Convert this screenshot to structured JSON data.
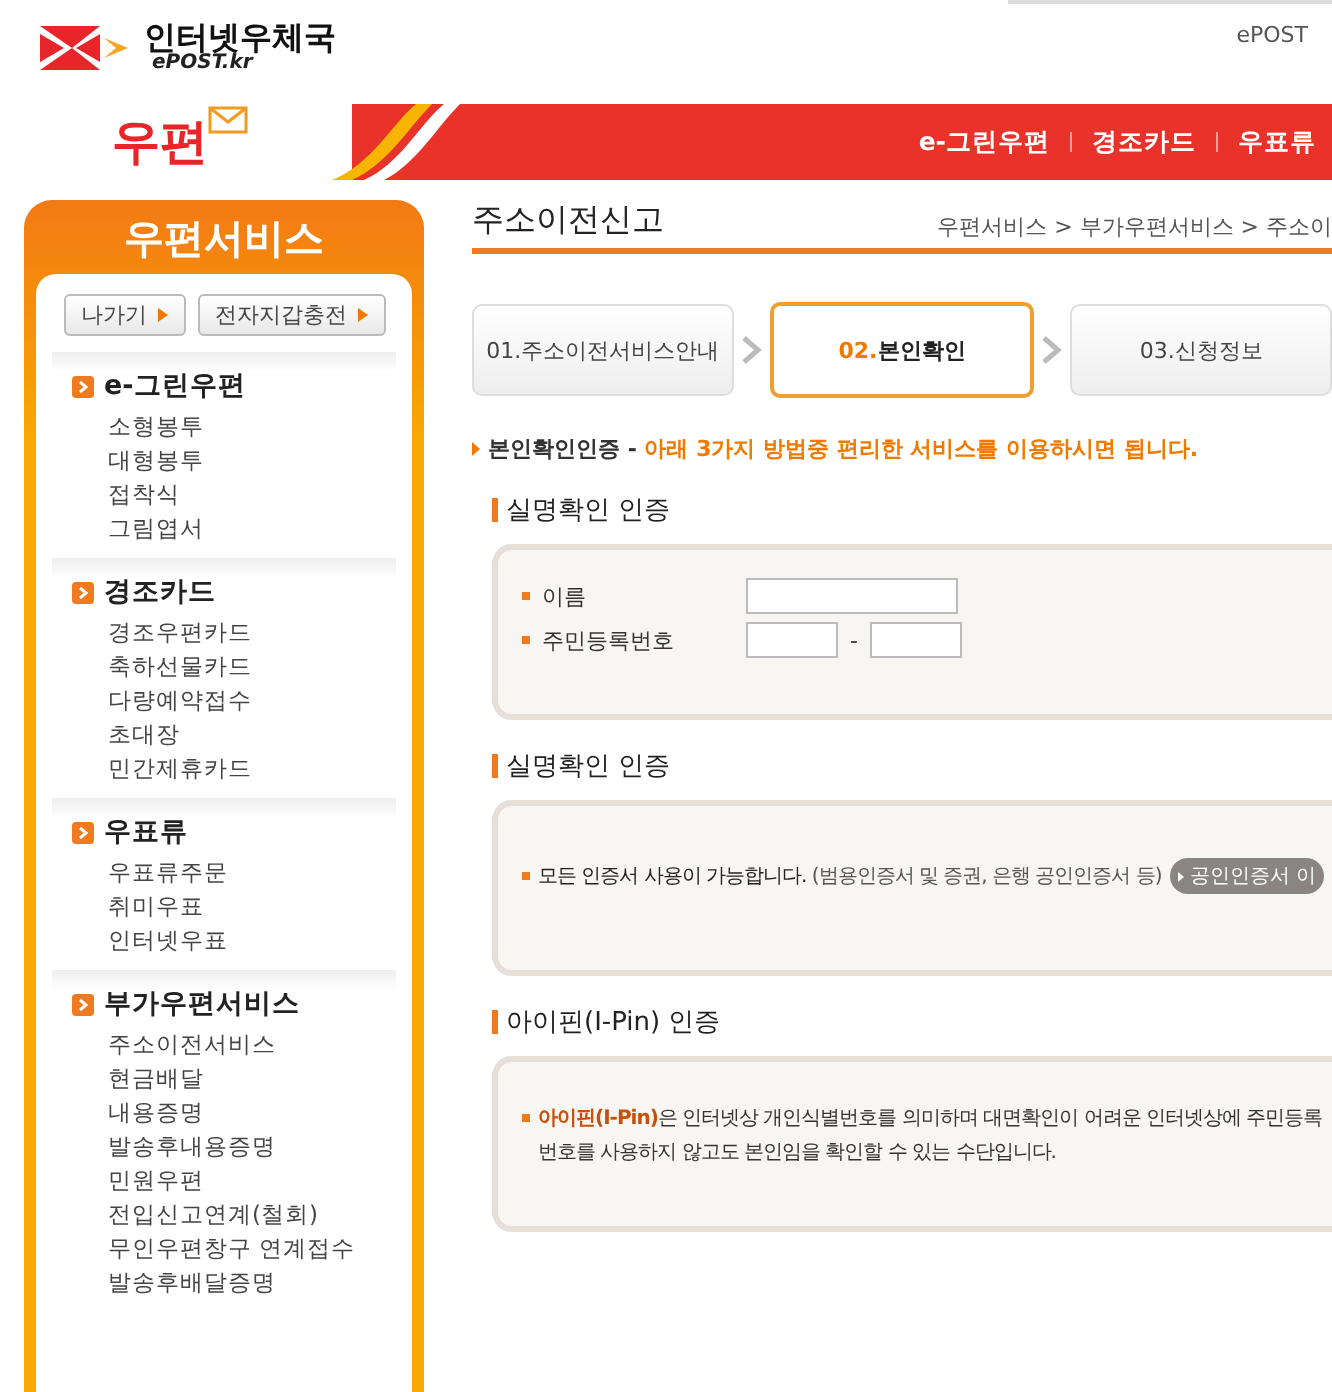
{
  "header": {
    "logo_title": "인터넷우체국",
    "logo_sub": "ePOST.kr",
    "top_link": "ePOST"
  },
  "banner": {
    "logo_text": "우편",
    "nav": [
      "e-그린우편",
      "경조카드",
      "우표류"
    ]
  },
  "sidebar": {
    "title": "우편서비스",
    "buttons": [
      "나가기",
      "전자지갑충전"
    ],
    "groups": [
      {
        "title": "e-그린우편",
        "items": [
          "소형봉투",
          "대형봉투",
          "접착식",
          "그림엽서"
        ]
      },
      {
        "title": "경조카드",
        "items": [
          "경조우편카드",
          "축하선물카드",
          "다량예약접수",
          "초대장",
          "민간제휴카드"
        ]
      },
      {
        "title": "우표류",
        "items": [
          "우표류주문",
          "취미우표",
          "인터넷우표"
        ]
      },
      {
        "title": "부가우편서비스",
        "items": [
          "주소이전서비스",
          "현금배달",
          "내용증명",
          "발송후내용증명",
          "민원우편",
          "전입신고연계(철회)",
          "무인우편창구 연계접수",
          "발송후배달증명"
        ]
      }
    ]
  },
  "main": {
    "title": "주소이전신고",
    "breadcrumb": "우편서비스 > 부가우편서비스 > 주소이",
    "steps": [
      {
        "number": "01.",
        "label": "주소이전서비스안내",
        "selected": false
      },
      {
        "number": "02.",
        "label": "본인확인",
        "selected": true
      },
      {
        "number": "03.",
        "label": "신청정보",
        "selected": false
      }
    ],
    "intro": {
      "label": "본인확인인증 - ",
      "text": "아래 3가지 방법중 편리한 서비스를 이용하시면 됩니다."
    },
    "sections": [
      {
        "kind": "form",
        "title": "실명확인 인증",
        "fields": [
          {
            "kind": "text",
            "label": "이름"
          },
          {
            "kind": "split",
            "label": "주민등록번호",
            "separator": "-"
          }
        ]
      },
      {
        "kind": "note",
        "title": "실명확인 인증",
        "text": "모든 인증서 사용이 가능합니다.",
        "sub": "(범용인증서 및 증권, 은행 공인인증서 등)",
        "button": "공인인증서 이"
      },
      {
        "kind": "ipin",
        "title": "아이핀(I-Pin) 인증",
        "highlight": "아이핀(I-Pin)",
        "text": "은 인터넷상 개인식별번호를 의미하며 대면확인이 어려운 인터넷상에 주민등록번호를 사용하지 않고도 본인임을 확인할 수 있는 수단입니다."
      }
    ]
  }
}
